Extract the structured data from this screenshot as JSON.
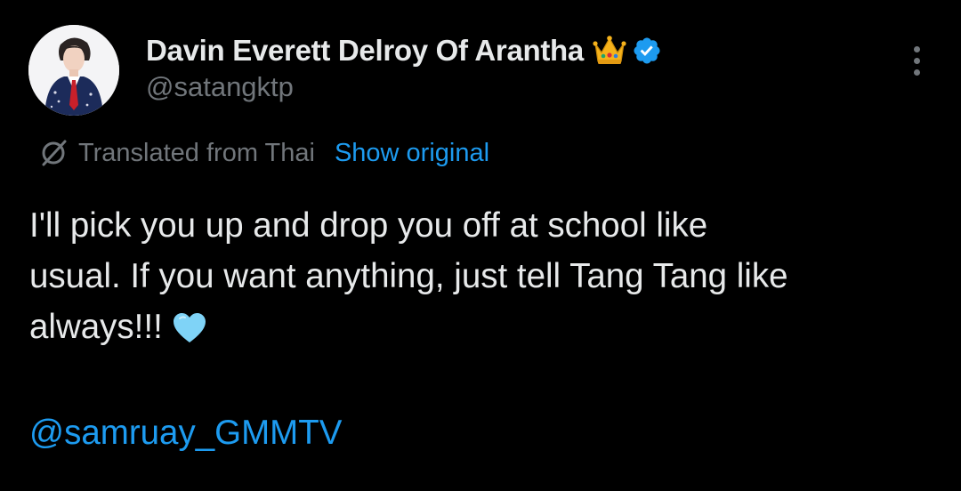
{
  "author": {
    "display_name": "Davin Everett Delroy Of Arantha",
    "handle": "@satangktp",
    "badges": [
      "crown-emoji",
      "verified-badge"
    ],
    "verified_color": "#1d9bf0"
  },
  "translation": {
    "label": "Translated from Thai",
    "action": "Show original"
  },
  "tweet": {
    "lines": [
      "I'll pick you up and drop you off at school like",
      "usual. If you want anything, just tell Tang Tang like",
      "always!!!"
    ],
    "emoji": "light-blue-heart",
    "mention": "@samruay_GMMTV"
  },
  "theme": {
    "background": "#000000",
    "text": "#e7e9ea",
    "secondary": "#71767b",
    "link": "#1d9bf0"
  },
  "icons": {
    "more": "more-vertical-icon",
    "translate": "translate-icon"
  }
}
